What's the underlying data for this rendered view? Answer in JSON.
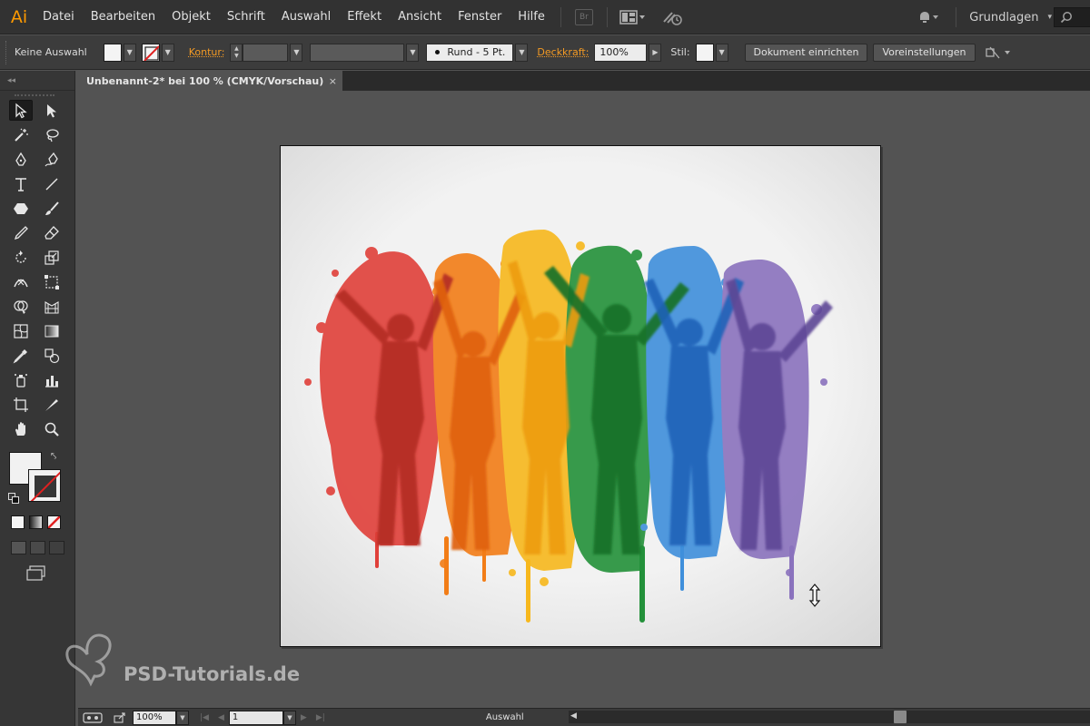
{
  "app": {
    "logo": "Ai"
  },
  "menu": {
    "items": [
      "Datei",
      "Bearbeiten",
      "Objekt",
      "Schrift",
      "Auswahl",
      "Effekt",
      "Ansicht",
      "Fenster",
      "Hilfe"
    ],
    "bridge_label": "Br",
    "workspace": "Grundlagen"
  },
  "control": {
    "selection_label": "Keine Auswahl",
    "stroke_link": "Kontur:",
    "brush_value": "Rund - 5 Pt.",
    "opacity_link": "Deckkraft:",
    "opacity_value": "100%",
    "style_label": "Stil:",
    "document_setup": "Dokument einrichten",
    "preferences": "Voreinstellungen"
  },
  "document": {
    "tab_title": "Unbenannt-2* bei 100 % (CMYK/Vorschau)",
    "close_glyph": "×"
  },
  "statusbar": {
    "zoom": "100%",
    "artboard_number": "1",
    "status_text": "Auswahl"
  },
  "watermark": {
    "text": "PSD-Tutorials.de"
  },
  "colors": {
    "accent_orange": "#f39a24",
    "artwork": [
      "#d8322a",
      "#f07a10",
      "#f7b51a",
      "#1f8a2e",
      "#2f7fd1",
      "#7a5fae"
    ]
  }
}
